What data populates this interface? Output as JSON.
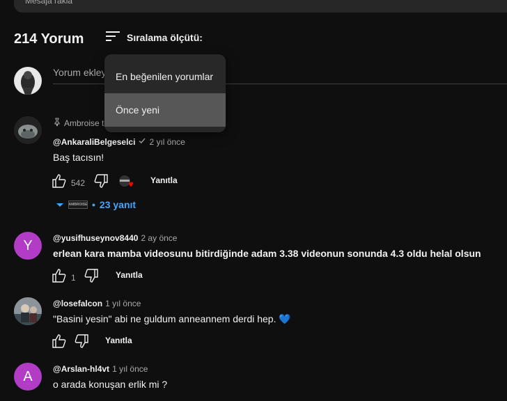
{
  "top_box": {
    "text": "Mesaja rakla"
  },
  "comments_header": {
    "count": "214 Yorum",
    "sort_label": "Sıralama ölçütü:"
  },
  "add_comment": {
    "placeholder": "Yorum ekleyin..."
  },
  "sort_menu": {
    "items": [
      {
        "label": "En beğenilen yorumlar"
      },
      {
        "label": "Önce yeni",
        "selected": true
      }
    ]
  },
  "comments": [
    {
      "pinned": "Ambroise ta",
      "author": "@AnkaraliBelgeselci",
      "verified": true,
      "time": "2 yıl önce",
      "text": "Baş tacısın!",
      "likes": "542",
      "reply_label": "Yanıtla",
      "replies_label": "23 yanıt",
      "replies_avatar_text": "AMBROISE"
    },
    {
      "avatar_letter": "Y",
      "avatar_color": "#b23cc6",
      "author": "@yusifhuseynov8440",
      "time": "2 ay önce",
      "text": "erlean kara mamba videosunu bitirdiğinde adam 3.38 videonun sonunda 4.3 oldu helal olsun",
      "likes": "1",
      "reply_label": "Yanıtla"
    },
    {
      "author": "@losefalcon",
      "time": "1 yıl önce",
      "text": "\"Basini yesin\" abi ne guldum anneannem derdi hep. 💙",
      "reply_label": "Yanıtla"
    },
    {
      "avatar_letter": "A",
      "avatar_color": "#b23cc6",
      "author": "@Arslan-hl4vt",
      "time": "1 yıl önce",
      "text": "o arada konuşan erlik mi ?"
    }
  ]
}
